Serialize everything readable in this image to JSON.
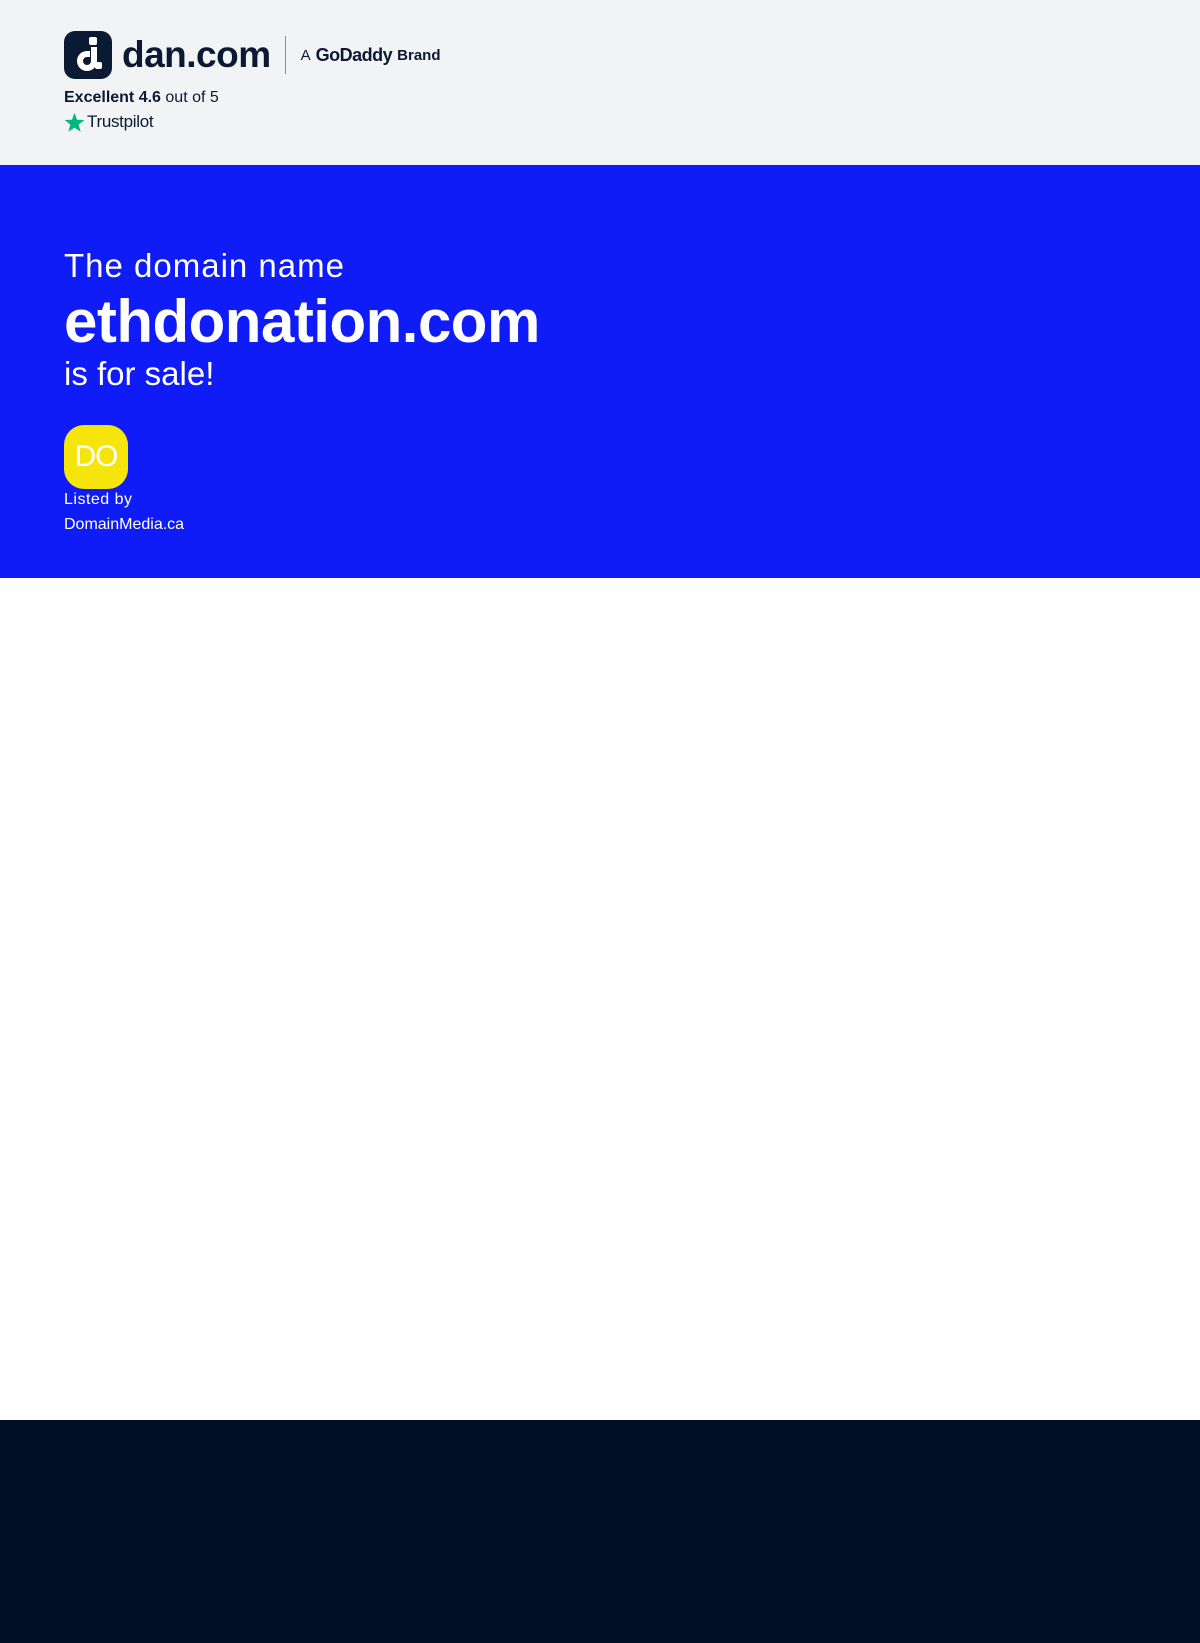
{
  "header": {
    "logo_text": "dan.com",
    "brand_prefix": "A",
    "brand_name": "GoDaddy",
    "brand_suffix": "Brand",
    "rating_label": "Excellent 4.6",
    "rating_suffix": "out of 5",
    "trustpilot_label": "Trustpilot",
    "logo_icon": "dan-logo-icon",
    "star_icon": "trustpilot-star-icon"
  },
  "hero": {
    "intro": "The domain name",
    "domain": "ethdonation.com",
    "outro": "is for sale!",
    "seller_initials": "DO",
    "listed_by_label": "Listed by",
    "seller_name": "DomainMedia.ca"
  },
  "colors": {
    "header_bg": "#f2f3f5",
    "hero_bg": "#0f1cf7",
    "avatar_bg": "#f5e50a",
    "footer_bg": "#000f26",
    "trustpilot_green": "#00b67a",
    "text_dark": "#0a1a33"
  }
}
